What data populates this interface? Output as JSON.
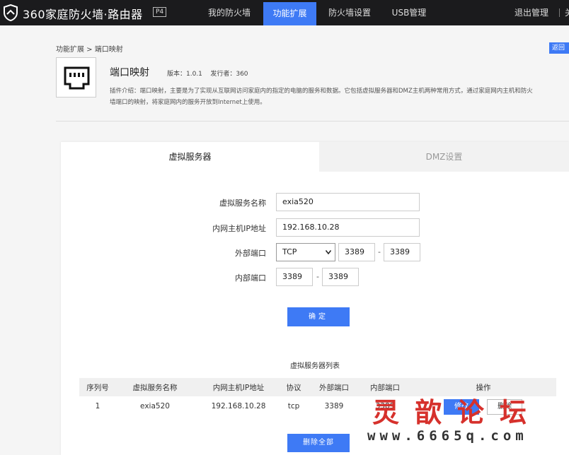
{
  "header": {
    "brand": "360家庭防火墙·路由器",
    "badge": "P4",
    "nav": [
      {
        "label": "我的防火墙"
      },
      {
        "label": "功能扩展"
      },
      {
        "label": "防火墙设置"
      },
      {
        "label": "USB管理"
      }
    ],
    "logout": "退出管理",
    "extra": "关"
  },
  "breadcrumb": "功能扩展 > 端口映射",
  "back_label": "返回",
  "plugin": {
    "name": "端口映射",
    "version": "版本：1.0.1",
    "publisher": "发行者：360",
    "desc_line1": "插件介绍：端口映射，主要是为了实现从互联网访问家庭内的指定的电脑的服务和数据。它包括虚拟服务器和DMZ主机两种常用方式，通过家庭网内主机和防火",
    "desc_line2": "墙端口的映射，将家庭网内的服务开放到Internet上使用。"
  },
  "tabs": [
    {
      "label": "虚拟服务器"
    },
    {
      "label": "DMZ设置"
    }
  ],
  "form": {
    "name_label": "虚拟服务名称",
    "name_value": "exia520",
    "ip_label": "内网主机IP地址",
    "ip_value": "192.168.10.28",
    "ext_label": "外部端口",
    "protocol": "TCP",
    "ext_start": "3389",
    "ext_end": "3389",
    "int_label": "内部端口",
    "int_start": "3389",
    "int_end": "3389",
    "dash": "-",
    "confirm": "确定"
  },
  "list": {
    "title": "虚拟服务器列表",
    "headers": [
      "序列号",
      "虚拟服务名称",
      "内网主机IP地址",
      "协议",
      "外部端口",
      "内部端口",
      "操作"
    ],
    "rows": [
      {
        "seq": "1",
        "name": "exia520",
        "ip": "192.168.10.28",
        "protocol": "tcp",
        "ext": "3389",
        "int": "3389"
      }
    ],
    "edit": "修改",
    "delete": "删除",
    "delete_all": "删除全部"
  },
  "watermark": {
    "title": "灵歆论坛",
    "url": "www.6665q.com"
  },
  "colors": {
    "accent": "#3e7af5",
    "header_bg": "#1b1b1d",
    "watermark": "#d6312c"
  }
}
